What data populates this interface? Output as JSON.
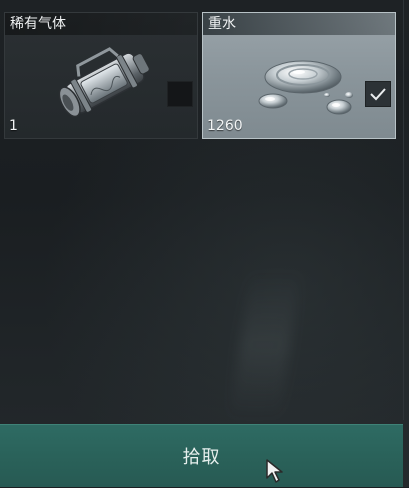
{
  "items": [
    {
      "name": "稀有气体",
      "count": "1",
      "icon": "gas-canister-icon",
      "selected": false
    },
    {
      "name": "重水",
      "count": "1260",
      "icon": "liquid-puddle-icon",
      "selected": true
    }
  ],
  "action": {
    "pickup_label": "拾取"
  },
  "colors": {
    "action_bar": "#2c6660",
    "selected_slot": "#8f9aa0",
    "unselected_slot": "#282d30"
  }
}
